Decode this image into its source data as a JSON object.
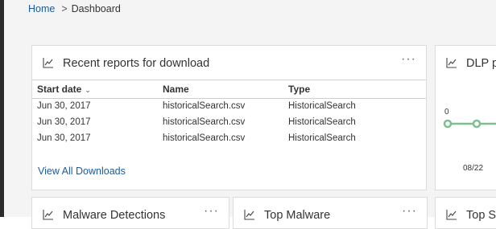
{
  "breadcrumb": {
    "home": "Home",
    "separator": ">",
    "current": "Dashboard"
  },
  "icons": {
    "chart": "line-chart-icon",
    "more": "more-options-icon",
    "sort": "chevron-down-icon"
  },
  "colors": {
    "link": "#1f5a98",
    "chart_line": "#7cc08f",
    "background": "#f4f4f4"
  },
  "reports_card": {
    "title": "Recent reports for download",
    "more": "···",
    "columns": {
      "start_date": "Start date",
      "name": "Name",
      "type": "Type"
    },
    "rows": [
      {
        "start_date": "Jun 30, 2017",
        "name": "historicalSearch.csv",
        "type": "HistoricalSearch"
      },
      {
        "start_date": "Jun 30, 2017",
        "name": "historicalSearch.csv",
        "type": "HistoricalSearch"
      },
      {
        "start_date": "Jun 30, 2017",
        "name": "historicalSearch.csv",
        "type": "HistoricalSearch"
      }
    ],
    "view_all": "View All Downloads"
  },
  "dlp_card": {
    "title": "DLP po",
    "chart_data": {
      "type": "line",
      "x": [
        "",
        "08/22",
        ""
      ],
      "series": [
        {
          "values": [
            0,
            0,
            0
          ]
        }
      ],
      "y_tick": "0",
      "x_tick": "08/22"
    }
  },
  "bottom_cards": [
    {
      "title": "Malware Detections",
      "more": "···"
    },
    {
      "title": "Top Malware",
      "more": "···"
    },
    {
      "title": "Top Se"
    }
  ]
}
